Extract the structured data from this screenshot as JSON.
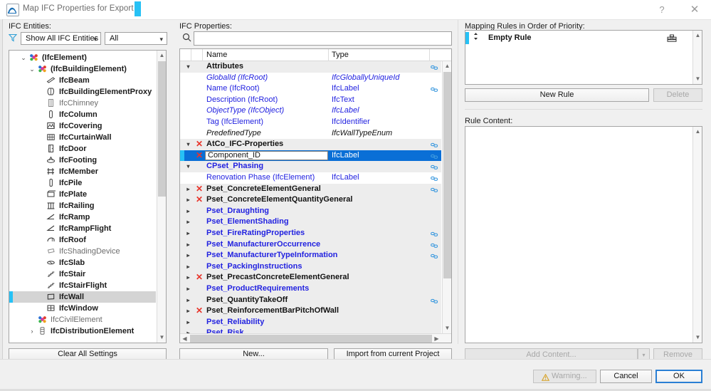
{
  "window": {
    "title": "Map IFC Properties for Export",
    "help_label": "?",
    "close_label": "✕"
  },
  "left_pane": {
    "label": "IFC Entities:",
    "filter_icon": "filter-icon",
    "entity_filter": {
      "value": "Show All IFC Entities"
    },
    "scope_filter": {
      "value": "All"
    },
    "clear_button": "Clear All Settings",
    "tree": [
      {
        "label": "(IfcElement)",
        "indent": 0,
        "twisty": "⌄",
        "icon": "ifc-group-icon",
        "style": "bold",
        "selected": false
      },
      {
        "label": "(IfcBuildingElement)",
        "indent": 1,
        "twisty": "⌄",
        "icon": "ifc-group-icon",
        "style": "bold",
        "selected": false
      },
      {
        "label": "IfcBeam",
        "indent": 2,
        "twisty": "",
        "icon": "beam-icon",
        "style": "bold",
        "selected": false
      },
      {
        "label": "IfcBuildingElementProxy",
        "indent": 2,
        "twisty": "",
        "icon": "proxy-icon",
        "style": "bold",
        "selected": false
      },
      {
        "label": "IfcChimney",
        "indent": 2,
        "twisty": "",
        "icon": "chimney-icon",
        "style": "grey",
        "selected": false
      },
      {
        "label": "IfcColumn",
        "indent": 2,
        "twisty": "",
        "icon": "column-icon",
        "style": "bold",
        "selected": false
      },
      {
        "label": "IfcCovering",
        "indent": 2,
        "twisty": "",
        "icon": "covering-icon",
        "style": "bold",
        "selected": false
      },
      {
        "label": "IfcCurtainWall",
        "indent": 2,
        "twisty": "",
        "icon": "curtainwall-icon",
        "style": "bold",
        "selected": false
      },
      {
        "label": "IfcDoor",
        "indent": 2,
        "twisty": "",
        "icon": "door-icon",
        "style": "bold",
        "selected": false
      },
      {
        "label": "IfcFooting",
        "indent": 2,
        "twisty": "",
        "icon": "footing-icon",
        "style": "bold",
        "selected": false
      },
      {
        "label": "IfcMember",
        "indent": 2,
        "twisty": "",
        "icon": "member-icon",
        "style": "bold",
        "selected": false
      },
      {
        "label": "IfcPile",
        "indent": 2,
        "twisty": "",
        "icon": "pile-icon",
        "style": "bold",
        "selected": false
      },
      {
        "label": "IfcPlate",
        "indent": 2,
        "twisty": "",
        "icon": "plate-icon",
        "style": "bold",
        "selected": false
      },
      {
        "label": "IfcRailing",
        "indent": 2,
        "twisty": "",
        "icon": "railing-icon",
        "style": "bold",
        "selected": false
      },
      {
        "label": "IfcRamp",
        "indent": 2,
        "twisty": "",
        "icon": "ramp-icon",
        "style": "bold",
        "selected": false
      },
      {
        "label": "IfcRampFlight",
        "indent": 2,
        "twisty": "",
        "icon": "rampflight-icon",
        "style": "bold",
        "selected": false
      },
      {
        "label": "IfcRoof",
        "indent": 2,
        "twisty": "",
        "icon": "roof-icon",
        "style": "bold",
        "selected": false
      },
      {
        "label": "IfcShadingDevice",
        "indent": 2,
        "twisty": "",
        "icon": "shadingdevice-icon",
        "style": "grey",
        "selected": false
      },
      {
        "label": "IfcSlab",
        "indent": 2,
        "twisty": "",
        "icon": "slab-icon",
        "style": "bold",
        "selected": false
      },
      {
        "label": "IfcStair",
        "indent": 2,
        "twisty": "",
        "icon": "stair-icon",
        "style": "bold",
        "selected": false
      },
      {
        "label": "IfcStairFlight",
        "indent": 2,
        "twisty": "",
        "icon": "stairflight-icon",
        "style": "bold",
        "selected": false
      },
      {
        "label": "IfcWall",
        "indent": 2,
        "twisty": "",
        "icon": "wall-icon",
        "style": "bold",
        "selected": true
      },
      {
        "label": "IfcWindow",
        "indent": 2,
        "twisty": "",
        "icon": "window-icon",
        "style": "bold",
        "selected": false
      },
      {
        "label": "IfcCivilElement",
        "indent": 1,
        "twisty": "",
        "icon": "ifc-group-icon",
        "style": "grey",
        "selected": false
      },
      {
        "label": "IfcDistributionElement",
        "indent": 1,
        "twisty": "›",
        "icon": "distribution-icon",
        "style": "bold",
        "selected": false
      }
    ]
  },
  "properties_pane": {
    "label": "IFC Properties:",
    "search_icon": "search-icon",
    "search_value": "",
    "columns": {
      "name": "Name",
      "type": "Type"
    },
    "new_button": "New...",
    "import_button": "Import from current Project",
    "rows": [
      {
        "kind": "group",
        "twisty": "▾",
        "x": false,
        "name": "Attributes",
        "type": "",
        "link": true,
        "italic": false,
        "color": "black",
        "selected": false
      },
      {
        "kind": "item",
        "twisty": "",
        "x": false,
        "name": "GlobalId (IfcRoot)",
        "type": "IfcGloballyUniqueId",
        "link": false,
        "italic": true,
        "color": "blue",
        "selected": false
      },
      {
        "kind": "item",
        "twisty": "",
        "x": false,
        "name": "Name (IfcRoot)",
        "type": "IfcLabel",
        "link": true,
        "italic": false,
        "color": "blue",
        "selected": false
      },
      {
        "kind": "item",
        "twisty": "",
        "x": false,
        "name": "Description (IfcRoot)",
        "type": "IfcText",
        "link": false,
        "italic": false,
        "color": "blue",
        "selected": false
      },
      {
        "kind": "item",
        "twisty": "",
        "x": false,
        "name": "ObjectType (IfcObject)",
        "type": "IfcLabel",
        "link": false,
        "italic": true,
        "color": "blue",
        "selected": false
      },
      {
        "kind": "item",
        "twisty": "",
        "x": false,
        "name": "Tag (IfcElement)",
        "type": "IfcIdentifier",
        "link": false,
        "italic": false,
        "color": "blue",
        "selected": false
      },
      {
        "kind": "item",
        "twisty": "",
        "x": false,
        "name": "PredefinedType",
        "type": "IfcWallTypeEnum",
        "link": false,
        "italic": true,
        "color": "black",
        "selected": false
      },
      {
        "kind": "group",
        "twisty": "▾",
        "x": true,
        "name": "AtCo_IFC-Properties",
        "type": "",
        "link": true,
        "italic": false,
        "color": "black",
        "selected": false
      },
      {
        "kind": "edit",
        "twisty": "",
        "x": true,
        "name": "Component_ID",
        "type": "IfcLabel",
        "link": true,
        "italic": false,
        "color": "black",
        "selected": true
      },
      {
        "kind": "group",
        "twisty": "▾",
        "x": false,
        "name": "CPset_Phasing",
        "type": "",
        "link": true,
        "italic": false,
        "color": "blue",
        "selected": false
      },
      {
        "kind": "item",
        "twisty": "",
        "x": false,
        "name": "Renovation Phase (IfcElement)",
        "type": "IfcLabel",
        "link": true,
        "italic": false,
        "color": "blue",
        "selected": false
      },
      {
        "kind": "group",
        "twisty": "▸",
        "x": true,
        "name": "Pset_ConcreteElementGeneral",
        "type": "",
        "link": true,
        "italic": false,
        "color": "black",
        "selected": false
      },
      {
        "kind": "group",
        "twisty": "▸",
        "x": true,
        "name": "Pset_ConcreteElementQuantityGeneral",
        "type": "",
        "link": false,
        "italic": false,
        "color": "black",
        "selected": false
      },
      {
        "kind": "group",
        "twisty": "▸",
        "x": false,
        "name": "Pset_Draughting",
        "type": "",
        "link": false,
        "italic": false,
        "color": "blue",
        "selected": false
      },
      {
        "kind": "group",
        "twisty": "▸",
        "x": false,
        "name": "Pset_ElementShading",
        "type": "",
        "link": false,
        "italic": false,
        "color": "blue",
        "selected": false
      },
      {
        "kind": "group",
        "twisty": "▸",
        "x": false,
        "name": "Pset_FireRatingProperties",
        "type": "",
        "link": true,
        "italic": false,
        "color": "blue",
        "selected": false
      },
      {
        "kind": "group",
        "twisty": "▸",
        "x": false,
        "name": "Pset_ManufacturerOccurrence",
        "type": "",
        "link": true,
        "italic": false,
        "color": "blue",
        "selected": false
      },
      {
        "kind": "group",
        "twisty": "▸",
        "x": false,
        "name": "Pset_ManufacturerTypeInformation",
        "type": "",
        "link": true,
        "italic": false,
        "color": "blue",
        "selected": false
      },
      {
        "kind": "group",
        "twisty": "▸",
        "x": false,
        "name": "Pset_PackingInstructions",
        "type": "",
        "link": false,
        "italic": false,
        "color": "blue",
        "selected": false
      },
      {
        "kind": "group",
        "twisty": "▸",
        "x": true,
        "name": "Pset_PrecastConcreteElementGeneral",
        "type": "",
        "link": false,
        "italic": false,
        "color": "black",
        "selected": false
      },
      {
        "kind": "group",
        "twisty": "▸",
        "x": false,
        "name": "Pset_ProductRequirements",
        "type": "",
        "link": false,
        "italic": false,
        "color": "blue",
        "selected": false
      },
      {
        "kind": "group",
        "twisty": "▸",
        "x": false,
        "name": "Pset_QuantityTakeOff",
        "type": "",
        "link": true,
        "italic": false,
        "color": "black",
        "selected": false
      },
      {
        "kind": "group",
        "twisty": "▸",
        "x": true,
        "name": "Pset_ReinforcementBarPitchOfWall",
        "type": "",
        "link": false,
        "italic": false,
        "color": "black",
        "selected": false
      },
      {
        "kind": "group",
        "twisty": "▸",
        "x": false,
        "name": "Pset_Reliability",
        "type": "",
        "link": false,
        "italic": false,
        "color": "blue",
        "selected": false
      },
      {
        "kind": "group",
        "twisty": "▸",
        "x": false,
        "name": "Pset_Risk",
        "type": "",
        "link": false,
        "italic": false,
        "color": "blue",
        "selected": false
      }
    ]
  },
  "rules_pane": {
    "label": "Mapping Rules in Order of Priority:",
    "rules": [
      {
        "label": "Empty Rule",
        "icon": "rule-stack-icon",
        "selected": true
      }
    ],
    "new_rule_button": "New Rule",
    "delete_button": "Delete",
    "rule_content_label": "Rule Content:",
    "add_content_button": "Add Content...",
    "remove_button": "Remove"
  },
  "footer": {
    "warning_button": "Warning...",
    "warning_icon": "warning-triangle-icon",
    "cancel_button": "Cancel",
    "ok_button": "OK"
  },
  "colors": {
    "accent_cyan": "#27c1f5",
    "selection_blue": "#0a6fd6",
    "link_blue": "#2222e0",
    "error_red": "#e8342a",
    "chrome_grey": "#f0f0f0"
  }
}
